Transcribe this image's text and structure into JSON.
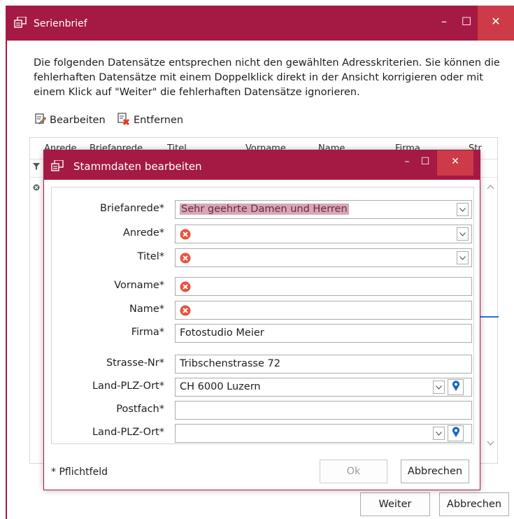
{
  "outer": {
    "title": "Serienbrief",
    "controls": {
      "minimize": "–",
      "maximize": "☐",
      "close": "✕"
    },
    "intro_text": "Die folgenden Datensätze entsprechen nicht den gewählten Adresskriterien. Sie können die fehlerhaften Datensätze mit einem Doppelklick direkt in der Ansicht korrigieren oder mit einem Klick auf \"Weiter\" die fehlerhaften Datensätze ignorieren.",
    "toolbar": {
      "edit_label": "Bearbeiten",
      "remove_label": "Entfernen"
    },
    "grid_columns": [
      "Anrede",
      "Briefanrede",
      "Titel",
      "Vorname",
      "Name",
      "Firma",
      "Str"
    ],
    "buttons": {
      "next_label": "Weiter",
      "cancel_label": "Abbrechen"
    }
  },
  "dialog": {
    "title": "Stammdaten bearbeiten",
    "controls": {
      "minimize": "–",
      "maximize": "☐",
      "close": "✕"
    },
    "fields": {
      "briefanrede": {
        "label": "Briefanrede*",
        "value": "Sehr geehrte Damen und Herren"
      },
      "anrede": {
        "label": "Anrede*",
        "value": ""
      },
      "titel": {
        "label": "Titel*",
        "value": ""
      },
      "vorname": {
        "label": "Vorname*",
        "value": ""
      },
      "name": {
        "label": "Name*",
        "value": ""
      },
      "firma": {
        "label": "Firma*",
        "value": "Fotostudio Meier"
      },
      "strasse": {
        "label": "Strasse-Nr*",
        "value": "Tribschenstrasse 72"
      },
      "land_plz_ort_1": {
        "label": "Land-PLZ-Ort*",
        "value": "CH 6000 Luzern"
      },
      "postfach": {
        "label": "Postfach*",
        "value": ""
      },
      "land_plz_ort_2": {
        "label": "Land-PLZ-Ort*",
        "value": ""
      }
    },
    "footer_note": "* Pflichtfeld",
    "buttons": {
      "ok_label": "Ok",
      "cancel_label": "Abbrechen"
    }
  },
  "icons": {
    "error": "error-circle-icon",
    "pin": "map-pin-icon",
    "dropdown": "chevron-down-icon"
  },
  "colors": {
    "accent": "#a51a44",
    "close_button": "#cc3b47",
    "error": "#e8533f",
    "highlight": "#d7a7b8",
    "pin": "#1565c0"
  }
}
